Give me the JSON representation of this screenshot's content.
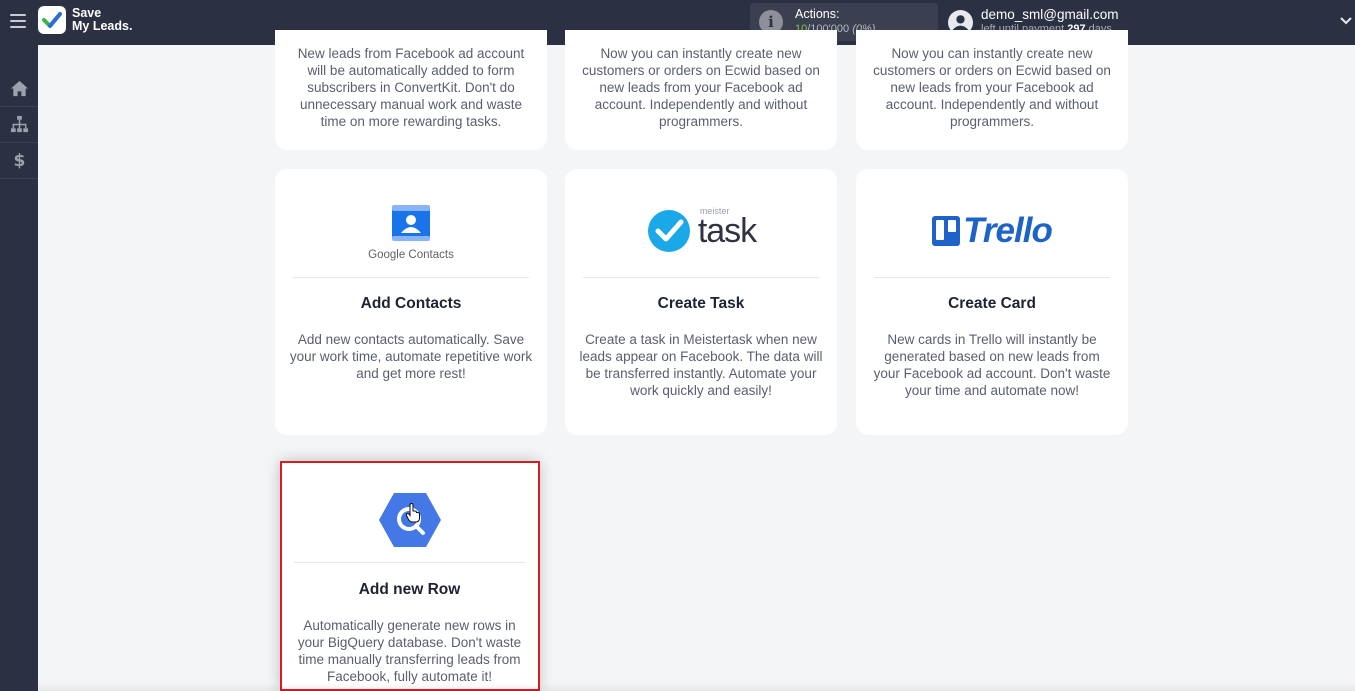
{
  "app": {
    "logo_line1": "Save",
    "logo_line2": "My Leads.",
    "brand_color": "#2b3043",
    "accent_green": "#7ec94b"
  },
  "header": {
    "actions_label": "Actions:",
    "actions_used": "10",
    "actions_total": "/100'000",
    "actions_percent": "(0%)",
    "user_email": "demo_sml@gmail.com",
    "payment_prefix": "left until payment",
    "payment_days": "297",
    "payment_suffix": "days"
  },
  "sidebar": {
    "items": [
      {
        "icon": "home-icon"
      },
      {
        "icon": "sitemap-icon"
      },
      {
        "icon": "dollar-icon"
      }
    ]
  },
  "cards_top": [
    {
      "desc": "New leads from Facebook ad account will be automatically added to form subscribers in ConvertKit. Don't do unnecessary manual work and waste time on more rewarding tasks."
    },
    {
      "desc": "Now you can instantly create new customers or orders on Ecwid based on new leads from your Facebook ad account. Independently and without programmers."
    },
    {
      "desc": "Now you can instantly create new customers or orders on Ecwid based on new leads from your Facebook ad account. Independently and without programmers."
    }
  ],
  "cards": [
    {
      "logo_label": "Google Contacts",
      "title": "Add Contacts",
      "desc": "Add new contacts automatically. Save your work time, automate repetitive work and get more rest!"
    },
    {
      "logo_small": "meister",
      "logo_word": "task",
      "title": "Create Task",
      "desc": "Create a task in Meistertask when new leads appear on Facebook. The data will be transferred instantly. Automate your work quickly and easily!"
    },
    {
      "logo_word": "Trello",
      "title": "Create Card",
      "desc": "New cards in Trello will instantly be generated based on new leads from your Facebook ad account. Don't waste your time and automate now!"
    },
    {
      "title": "Add new Row",
      "desc": "Automatically generate new rows in your BigQuery database. Don't waste time manually transferring leads from Facebook, fully automate it!",
      "highlight_color": "#d51c22"
    }
  ]
}
